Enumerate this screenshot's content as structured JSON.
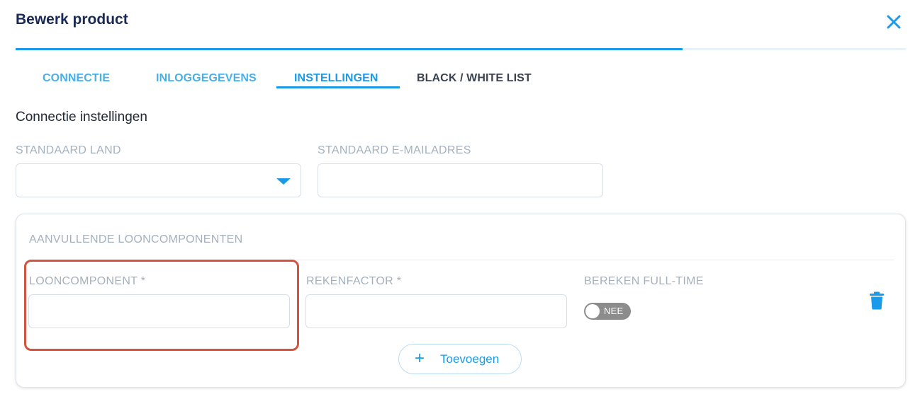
{
  "header": {
    "title": "Bewerk product",
    "close_icon": "close-icon"
  },
  "progress": {
    "fraction": 0.75,
    "fill_color": "#1a9ae8",
    "track_color": "#e8f2fa"
  },
  "tabs": [
    {
      "label": "CONNECTIE",
      "active": false
    },
    {
      "label": "INLOGGEGEVENS",
      "active": false
    },
    {
      "label": "INSTELLINGEN",
      "active": true
    },
    {
      "label": "BLACK / WHITE LIST",
      "active": false
    }
  ],
  "section": {
    "title": "Connectie instellingen"
  },
  "fields": {
    "standaard_land": {
      "label": "STANDAARD LAND",
      "value": ""
    },
    "standaard_email": {
      "label": "STANDAARD E-MAILADRES",
      "value": ""
    }
  },
  "card": {
    "title": "AANVULLENDE LOONCOMPONENTEN",
    "row": {
      "looncomponent": {
        "label": "LOONCOMPONENT *",
        "value": ""
      },
      "rekenfactor": {
        "label": "REKENFACTOR *",
        "value": ""
      },
      "bereken_fulltime": {
        "label": "BEREKEN FULL-TIME",
        "toggle_text": "NEE",
        "on": false
      },
      "delete_icon": "trash-icon"
    },
    "add_button": {
      "label": "Toevoegen",
      "icon": "plus-icon"
    }
  },
  "colors": {
    "accent": "#1a9ae8",
    "title": "#1b2a55",
    "highlight": "#d4533f",
    "toggle_off": "#8c8c8c"
  }
}
